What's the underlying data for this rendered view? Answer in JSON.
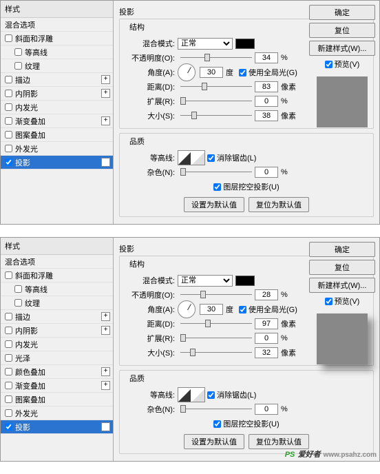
{
  "sidebar": {
    "head": "样式",
    "opt": "混合选项",
    "items": [
      "斜面和浮雕",
      "等高线",
      "纹理",
      "描边",
      "内阴影",
      "内发光",
      "光泽",
      "颜色叠加",
      "渐变叠加",
      "图案叠加",
      "外发光",
      "投影"
    ]
  },
  "labels": {
    "sectionTitle": "投影",
    "struct": "结构",
    "blend": "混合模式:",
    "opacity": "不透明度(O):",
    "angle": "角度(A):",
    "deg": "度",
    "globalLight": "使用全局光(G)",
    "distance": "距离(D):",
    "spread": "扩展(R):",
    "size": "大小(S):",
    "px": "像素",
    "quality": "品质",
    "contour": "等高线:",
    "anti": "消除锯齿(L)",
    "noise": "杂色(N):",
    "knockout": "图层挖空投影(U)",
    "setDefault": "设置为默认值",
    "reset": "复位为默认值",
    "ok": "确定",
    "cancel": "复位",
    "newStyle": "新建样式(W)...",
    "preview": "预览(V)",
    "pct": "%",
    "normal": "正常"
  },
  "p1": {
    "opacity": 34,
    "angle": 30,
    "distance": 83,
    "spread": 0,
    "size": 38,
    "noise": 0
  },
  "p2": {
    "opacity": 28,
    "angle": 30,
    "distance": 97,
    "spread": 0,
    "size": 32,
    "noise": 0
  },
  "wm": {
    "t1": "PS",
    "t2": "爱好者",
    "url": "www.psahz.com"
  }
}
